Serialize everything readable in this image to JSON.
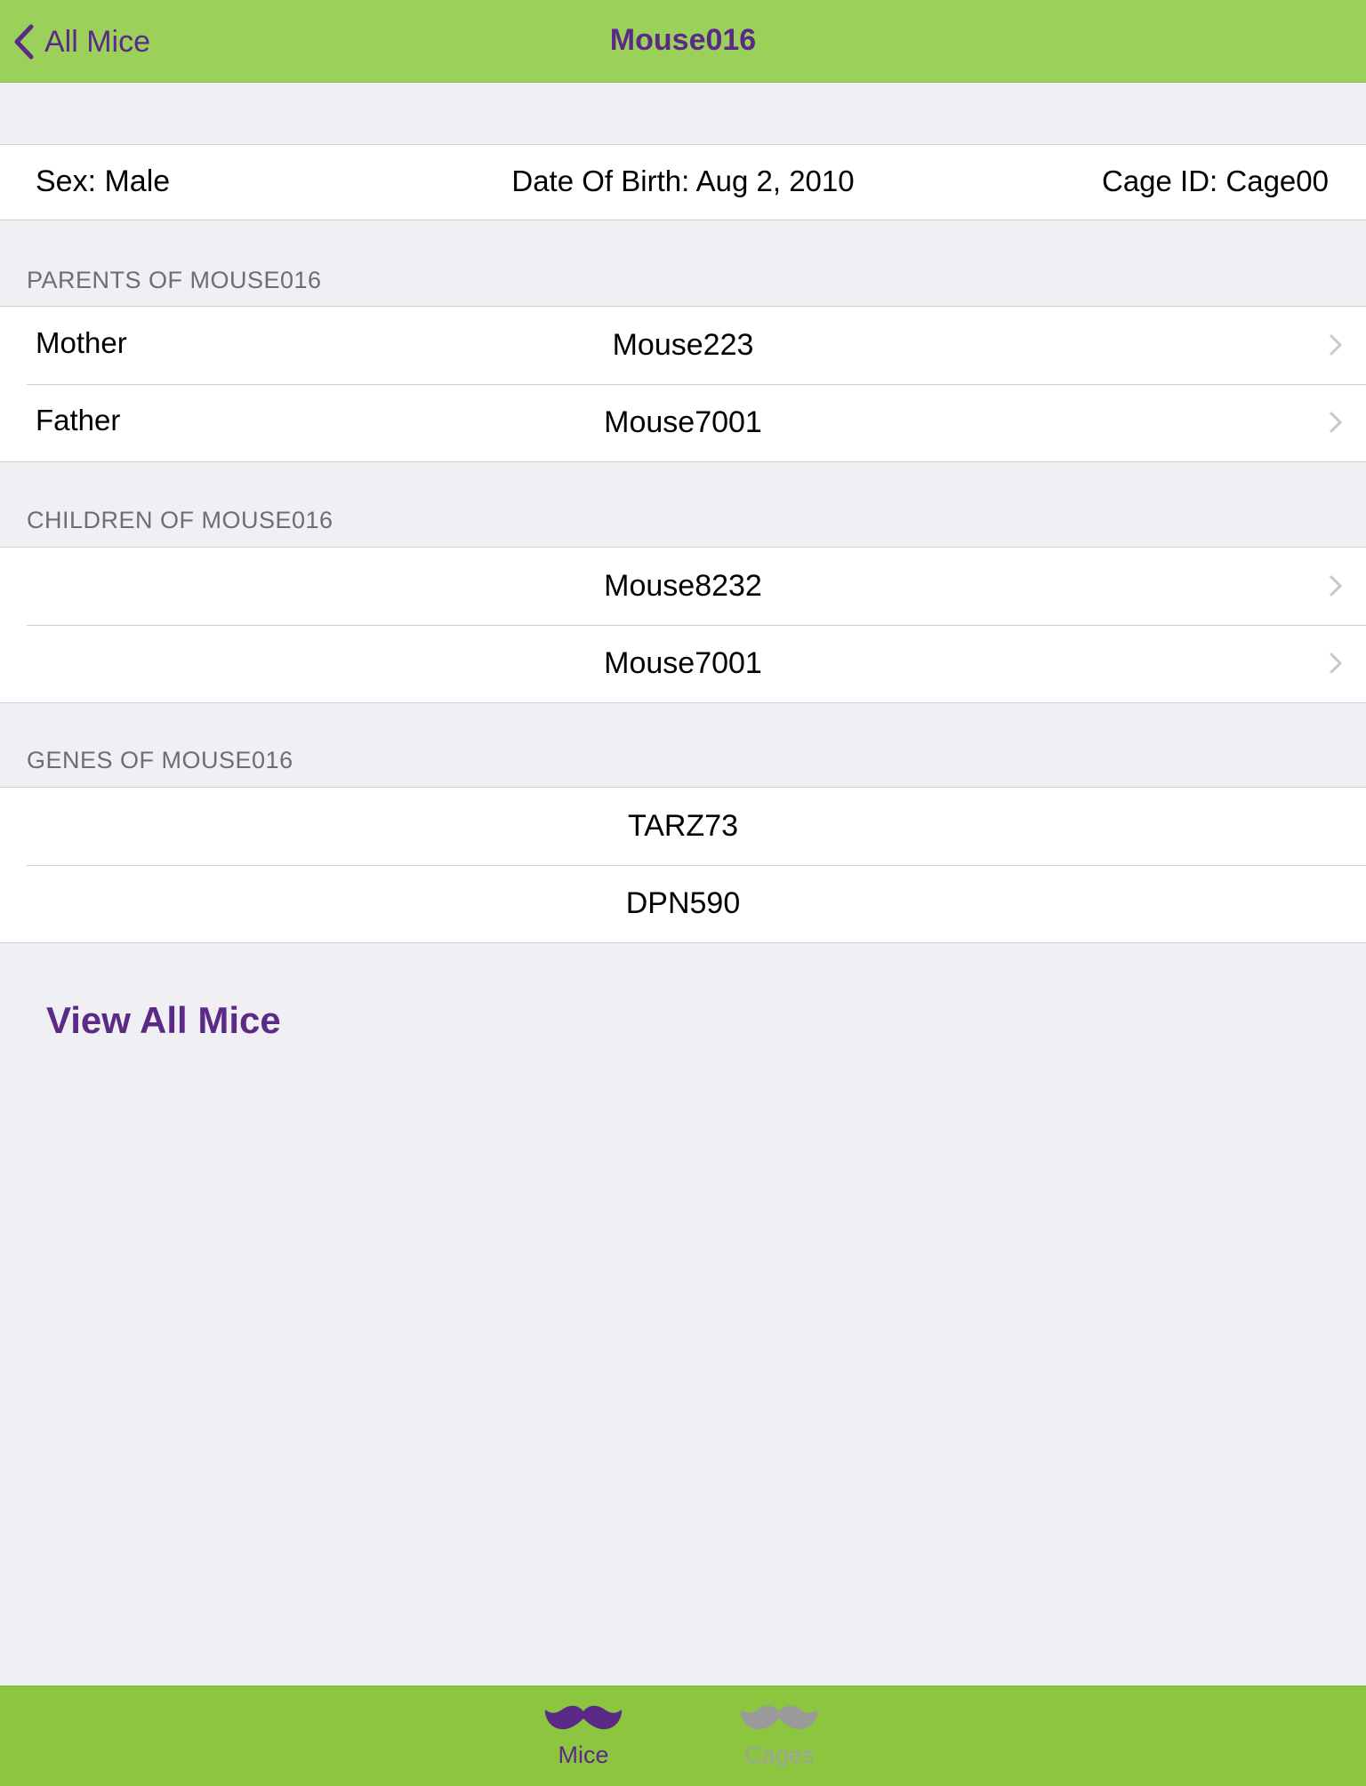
{
  "navbar": {
    "back_label": "All Mice",
    "title": "Mouse016"
  },
  "info": {
    "sex": "Sex: Male",
    "dob": "Date Of Birth: Aug 2, 2010",
    "cage": "Cage ID: Cage00"
  },
  "parents": {
    "header": "PARENTS OF MOUSE016",
    "rows": [
      {
        "label": "Mother",
        "value": "Mouse223"
      },
      {
        "label": "Father",
        "value": "Mouse7001"
      }
    ]
  },
  "children": {
    "header": "CHILDREN OF MOUSE016",
    "rows": [
      {
        "value": "Mouse8232"
      },
      {
        "value": "Mouse7001"
      }
    ]
  },
  "genes": {
    "header": "GENES OF MOUSE016",
    "rows": [
      {
        "value": "TARZ73"
      },
      {
        "value": "DPN590"
      }
    ]
  },
  "view_all_label": "View All Mice",
  "tabbar": {
    "tabs": [
      {
        "label": "Mice",
        "icon": "mustache-icon",
        "selected": true
      },
      {
        "label": "Cages",
        "icon": "mustache-icon",
        "selected": false
      }
    ]
  },
  "colors": {
    "accent": "#5b2a86",
    "navbar_bg": "#9bd05b",
    "tabbar_bg": "#8cc63f",
    "tab_inactive": "#9a9a9a",
    "background": "#efeff4"
  }
}
